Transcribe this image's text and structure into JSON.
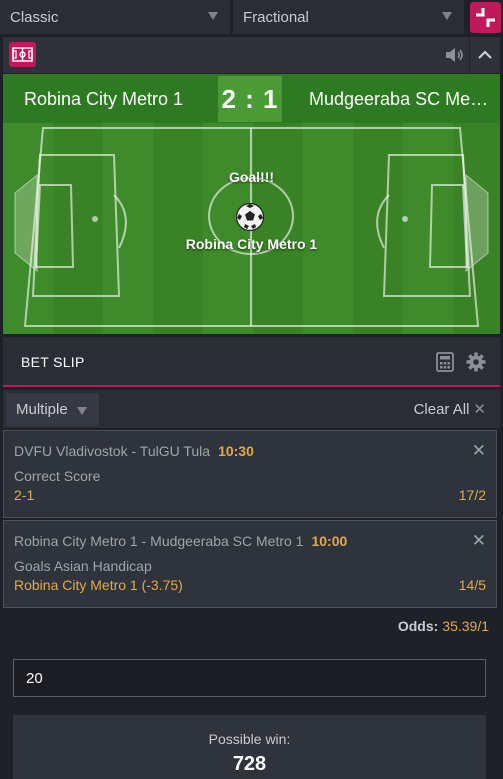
{
  "selectors": {
    "view": "Classic",
    "odds_format": "Fractional"
  },
  "match": {
    "home_team": "Robina City Metro 1",
    "away_team": "Mudgeeraba SC Metr…",
    "score": "2 : 1",
    "event_title": "Goal!!!",
    "event_team": "Robina City Metro 1"
  },
  "betslip": {
    "title": "BET SLIP",
    "mode": "Multiple",
    "clear_all": "Clear All",
    "bets": [
      {
        "match": "DVFU Vladivostok - TulGU Tula",
        "time": "10:30",
        "market": "Correct Score",
        "selection": "2-1",
        "odds": "17/2"
      },
      {
        "match": "Robina City Metro 1 - Mudgeeraba SC Metro 1",
        "time": "10:00",
        "market": "Goals Asian Handicap",
        "selection": "Robina City Metro 1 (-3.75)",
        "odds": "14/5"
      }
    ],
    "odds_label": "Odds:",
    "total_odds": "35.39/1",
    "stake": "20",
    "possible_win_label": "Possible win:",
    "possible_win": "728"
  },
  "colors": {
    "accent": "#c2185b",
    "odds": "#e2a94a",
    "background": "#1e2126",
    "pitch": "#3f8a2a"
  },
  "icons": [
    "chevron-down-icon",
    "collapse-icon",
    "pitch-icon",
    "sound-icon",
    "chevron-up-icon",
    "calculator-icon",
    "gear-icon",
    "close-icon",
    "ball-icon"
  ]
}
